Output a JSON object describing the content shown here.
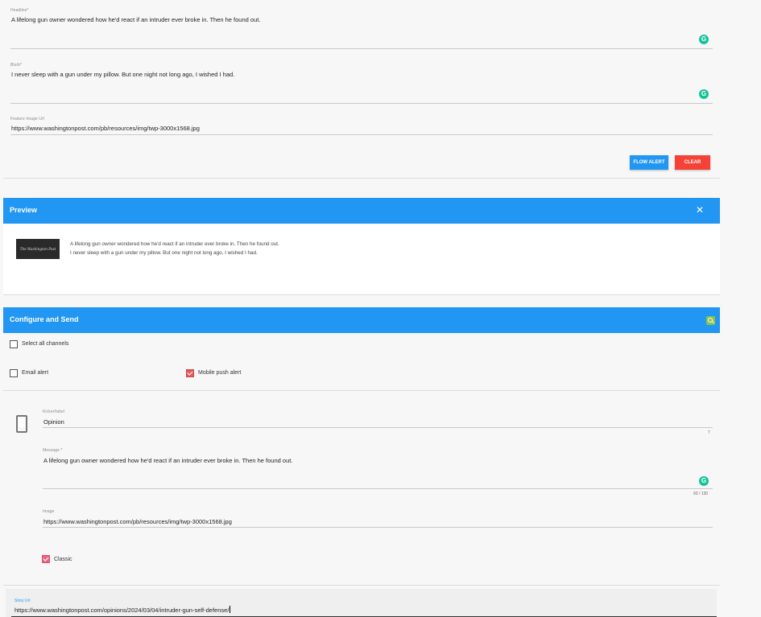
{
  "form": {
    "headline": {
      "label": "Headline*",
      "value": "A lifelong gun owner wondered how he'd react if an intruder ever broke in. Then he found out."
    },
    "blurb": {
      "label": "Blurb*",
      "value": "I never sleep with a gun under my pillow. But one night not long ago, I wished I had."
    },
    "feature_image": {
      "label": "Feature Image Url",
      "value": "https://www.washingtonpost.com/pb/resources/img/twp-3000x1568.jpg"
    },
    "grammarly_badge": "G",
    "buttons": {
      "flow_alert": "FLOW ALERT",
      "clear": "CLEAR"
    }
  },
  "preview": {
    "title": "Preview",
    "close_glyph": "✕",
    "thumb_text": "The Washington Post",
    "headline": "A lifelong gun owner wondered how he'd react if an intruder ever broke in. Then he found out.",
    "blurb": "I never sleep with a gun under my pillow. But one night not long ago, I wished I had."
  },
  "configure": {
    "title": "Configure and Send",
    "select_all": {
      "label": "Select all channels",
      "checked": false
    },
    "channels": [
      {
        "label": "Email alert",
        "checked": false
      },
      {
        "label": "Mobile push alert",
        "checked": true
      }
    ],
    "mobile": {
      "kicker": {
        "label": "Kicker/label",
        "value": "Opinion",
        "count": "7"
      },
      "message": {
        "label": "Message *",
        "value": "A lifelong gun owner wondered how he'd react if an intruder ever broke in. Then he found out.",
        "count": "93 / 130"
      },
      "image": {
        "label": "Image",
        "value": "https://www.washingtonpost.com/pb/resources/img/twp-3000x1568.jpg"
      },
      "classic": {
        "label": "Classic",
        "checked": true
      }
    },
    "story_url": {
      "label": "Story Url",
      "value": "https://www.washingtonpost.com/opinions/2024/03/04/intruder-gun-self-defense/"
    }
  },
  "colors": {
    "primary": "#2196f3",
    "danger": "#f44336",
    "grammarly": "#15c39a",
    "checkbox_checked": "#e05a5a"
  },
  "icons": {
    "grammarly": "grammarly-icon",
    "close": "close-icon",
    "zoom": "zoom-icon",
    "phone": "phone-icon"
  }
}
